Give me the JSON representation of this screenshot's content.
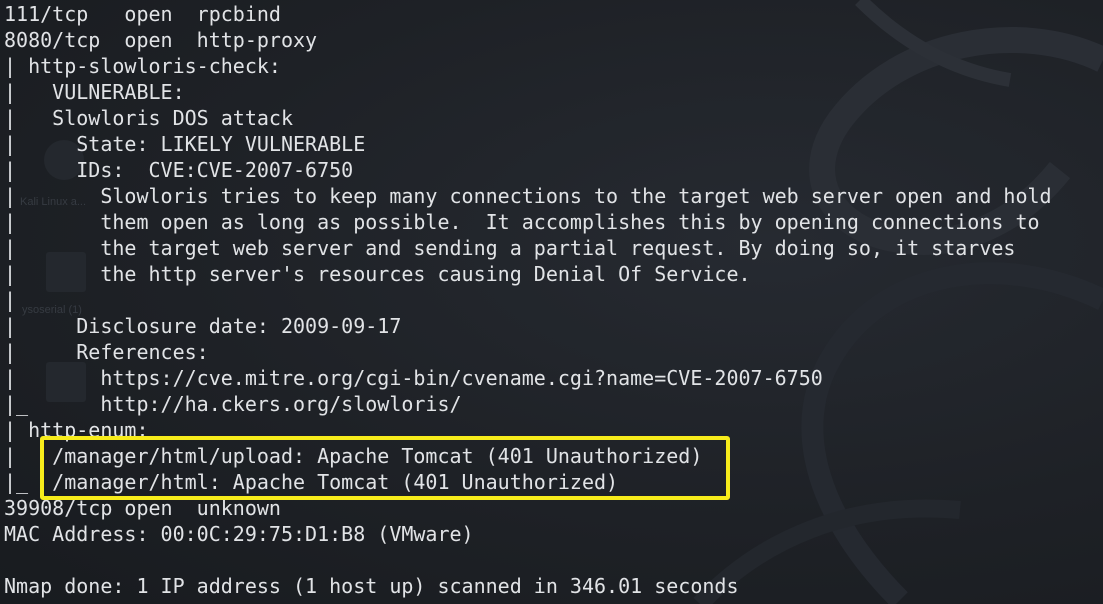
{
  "terminal": {
    "lines": [
      "111/tcp   open  rpcbind",
      "8080/tcp  open  http-proxy",
      "| http-slowloris-check:",
      "|   VULNERABLE:",
      "|   Slowloris DOS attack",
      "|     State: LIKELY VULNERABLE",
      "|     IDs:  CVE:CVE-2007-6750",
      "|       Slowloris tries to keep many connections to the target web server open and hold",
      "|       them open as long as possible.  It accomplishes this by opening connections to",
      "|       the target web server and sending a partial request. By doing so, it starves",
      "|       the http server's resources causing Denial Of Service.",
      "|",
      "|     Disclosure date: 2009-09-17",
      "|     References:",
      "|       https://cve.mitre.org/cgi-bin/cvename.cgi?name=CVE-2007-6750",
      "|_      http://ha.ckers.org/slowloris/",
      "| http-enum:",
      "|   /manager/html/upload: Apache Tomcat (401 Unauthorized)",
      "|_  /manager/html: Apache Tomcat (401 Unauthorized)",
      "39908/tcp open  unknown",
      "MAC Address: 00:0C:29:75:D1:B8 (VMware)",
      "",
      "Nmap done: 1 IP address (1 host up) scanned in 346.01 seconds"
    ]
  },
  "background": {
    "desktop_labels": [
      "Kali Linux a...",
      "ysoserial (1)"
    ]
  },
  "colors": {
    "terminal_bg": "#1e2126",
    "text": "#e1e3e6",
    "highlight": "#f7ec1b"
  }
}
